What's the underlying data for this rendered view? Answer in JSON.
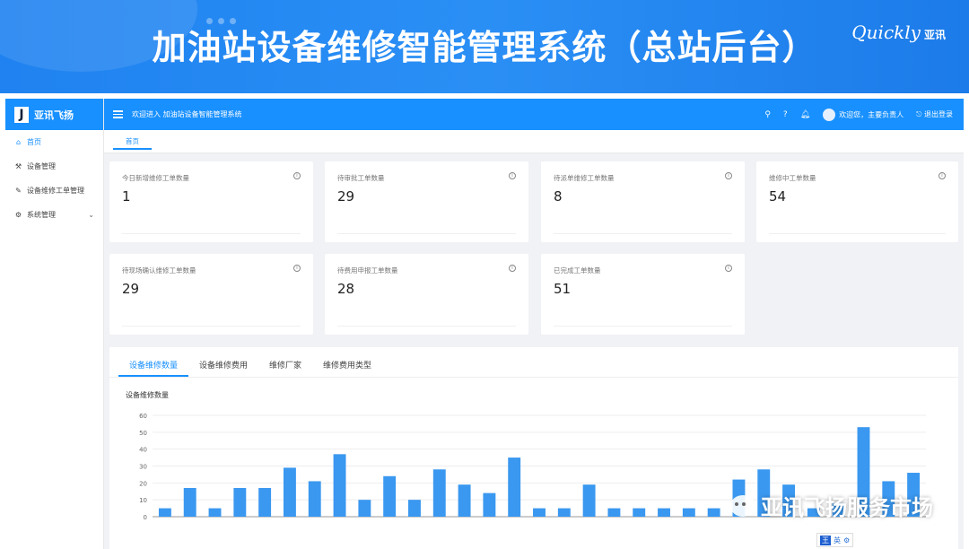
{
  "banner": {
    "title": "加油站设备维修智能管理系统（总站后台）",
    "brand_en": "Quickly",
    "brand_cn": "亚讯"
  },
  "sidebar": {
    "logo_letter": "J",
    "logo_text": "亚讯飞扬",
    "items": [
      {
        "label": "首页",
        "icon": "home-icon",
        "active": true
      },
      {
        "label": "设备管理",
        "icon": "tool-icon"
      },
      {
        "label": "设备维修工单管理",
        "icon": "edit-icon"
      },
      {
        "label": "系统管理",
        "icon": "gear-icon",
        "expandable": true
      }
    ]
  },
  "topbar": {
    "welcome": "欢迎进入 加油站设备智能管理系统",
    "user_greeting": "欢迎您，主要负责人",
    "logout": "退出登录"
  },
  "tabs": {
    "home": "首页"
  },
  "stats": [
    {
      "label": "今日新增维修工单数量",
      "value": "1"
    },
    {
      "label": "待审批工单数量",
      "value": "29"
    },
    {
      "label": "待派单维修工单数量",
      "value": "8"
    },
    {
      "label": "维修中工单数量",
      "value": "54"
    },
    {
      "label": "待现场确认维修工单数量",
      "value": "29"
    },
    {
      "label": "待费用申报工单数量",
      "value": "28"
    },
    {
      "label": "已完成工单数量",
      "value": "51"
    }
  ],
  "chart_tabs": [
    "设备维修数量",
    "设备维修费用",
    "维修厂家",
    "维修费用类型"
  ],
  "active_chart_tab": 0,
  "chart_data": {
    "type": "bar",
    "title": "设备维修数量",
    "ylim": [
      0,
      60
    ],
    "yticks": [
      0,
      10,
      20,
      30,
      40,
      50,
      60
    ],
    "values": [
      5,
      17,
      5,
      17,
      17,
      29,
      21,
      37,
      10,
      24,
      10,
      28,
      19,
      14,
      35,
      5,
      5,
      19,
      5,
      5,
      5,
      5,
      5,
      22,
      28,
      19,
      5,
      8,
      53,
      21,
      26
    ],
    "color": "#3a98f0",
    "grid": true
  },
  "watermark": "亚讯飞扬服务市场",
  "ime": {
    "key": "王",
    "mode": "英"
  }
}
